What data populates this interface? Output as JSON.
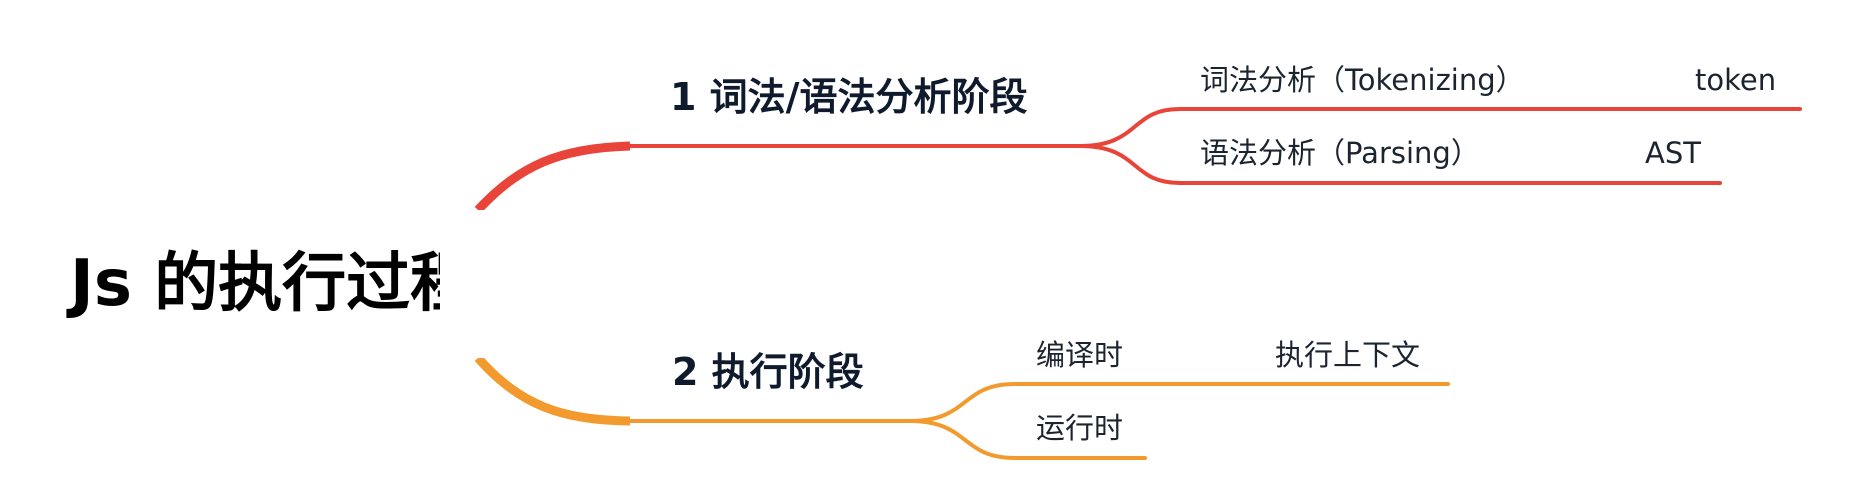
{
  "root": {
    "label": "Js 的执行过程"
  },
  "branches": [
    {
      "label": "1 词法/语法分析阶段",
      "color": "#e8443a",
      "children": [
        {
          "label": "词法分析（Tokenizing）",
          "child": "token"
        },
        {
          "label": "语法分析（Parsing）",
          "child": "AST"
        }
      ]
    },
    {
      "label": "2 执行阶段",
      "color": "#f39a2e",
      "children": [
        {
          "label": "编译时",
          "child": "执行上下文"
        },
        {
          "label": "运行时",
          "child": ""
        }
      ]
    }
  ]
}
